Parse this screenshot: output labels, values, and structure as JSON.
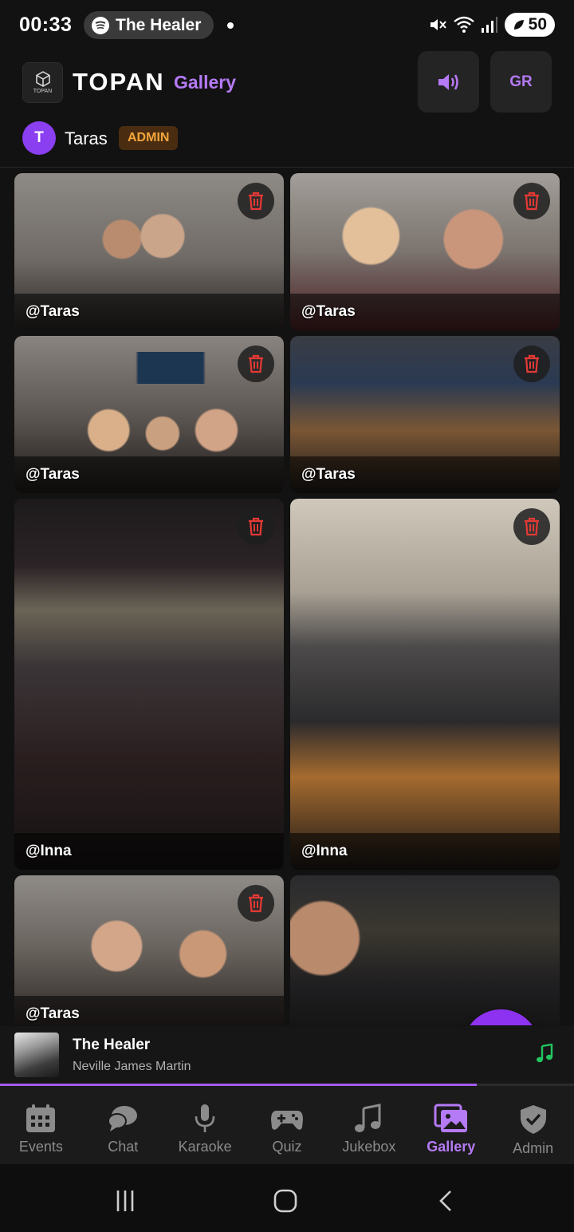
{
  "status_bar": {
    "time": "00:33",
    "now_playing_pill": "The Healer",
    "battery": "50"
  },
  "header": {
    "logo_text": "TOPAN",
    "brand": "TOPAN",
    "section": "Gallery",
    "lang_button": "GR",
    "user": {
      "initial": "T",
      "name": "Taras",
      "role": "ADMIN"
    }
  },
  "gallery": {
    "photos": [
      {
        "author": "@Taras"
      },
      {
        "author": "@Taras"
      },
      {
        "author": "@Taras"
      },
      {
        "author": "@Taras"
      },
      {
        "author": "@Inna"
      },
      {
        "author": "@Inna"
      },
      {
        "author": "@Taras"
      },
      {
        "author": ""
      }
    ]
  },
  "player": {
    "title": "The Healer",
    "artist": "Neville James Martin",
    "progress": 0.83
  },
  "nav": {
    "items": [
      {
        "label": "Events",
        "icon": "calendar-icon"
      },
      {
        "label": "Chat",
        "icon": "chat-icon"
      },
      {
        "label": "Karaoke",
        "icon": "microphone-icon"
      },
      {
        "label": "Quiz",
        "icon": "gamepad-icon"
      },
      {
        "label": "Jukebox",
        "icon": "music-note-icon"
      },
      {
        "label": "Gallery",
        "icon": "gallery-icon"
      },
      {
        "label": "Admin",
        "icon": "shield-check-icon"
      }
    ],
    "active": "Gallery"
  },
  "colors": {
    "accent": "#b57af5",
    "fab": "#8d32f0",
    "admin_badge_bg": "#4a2d10",
    "admin_badge_text": "#f2a53b",
    "delete_icon": "#e53935",
    "music_note": "#22c55e"
  }
}
